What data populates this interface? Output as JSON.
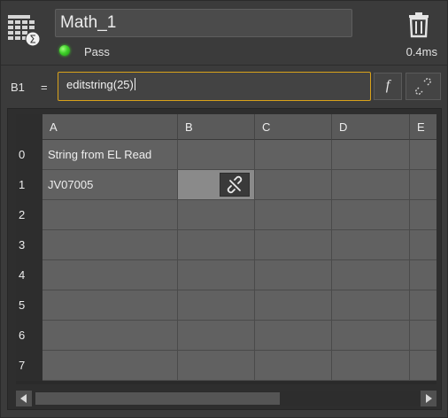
{
  "tool": {
    "icon": "spreadsheet-sum-icon",
    "name": "Math_1",
    "status": "Pass",
    "status_color": "#3fd12a",
    "time": "0.4ms",
    "delete_icon": "trash-icon"
  },
  "formula": {
    "cell_ref": "B1",
    "equals": "=",
    "value": "editstring(25)",
    "fx_label": "f",
    "link_icon": "broken-link-icon"
  },
  "grid": {
    "columns": [
      "A",
      "B",
      "C",
      "D",
      "E"
    ],
    "rows": [
      {
        "index": "0",
        "cells": [
          "String from EL Read",
          "",
          "",
          "",
          ""
        ]
      },
      {
        "index": "1",
        "cells": [
          "JV07005",
          "",
          "",
          "",
          ""
        ]
      },
      {
        "index": "2",
        "cells": [
          "",
          "",
          "",
          "",
          ""
        ]
      },
      {
        "index": "3",
        "cells": [
          "",
          "",
          "",
          "",
          ""
        ]
      },
      {
        "index": "4",
        "cells": [
          "",
          "",
          "",
          "",
          ""
        ]
      },
      {
        "index": "5",
        "cells": [
          "",
          "",
          "",
          "",
          ""
        ]
      },
      {
        "index": "6",
        "cells": [
          "",
          "",
          "",
          "",
          ""
        ]
      },
      {
        "index": "7",
        "cells": [
          "",
          "",
          "",
          "",
          ""
        ]
      }
    ],
    "selected_cell": "B1",
    "cell_link_icon": "broken-link-icon"
  },
  "accent_color": "#d9a21a"
}
